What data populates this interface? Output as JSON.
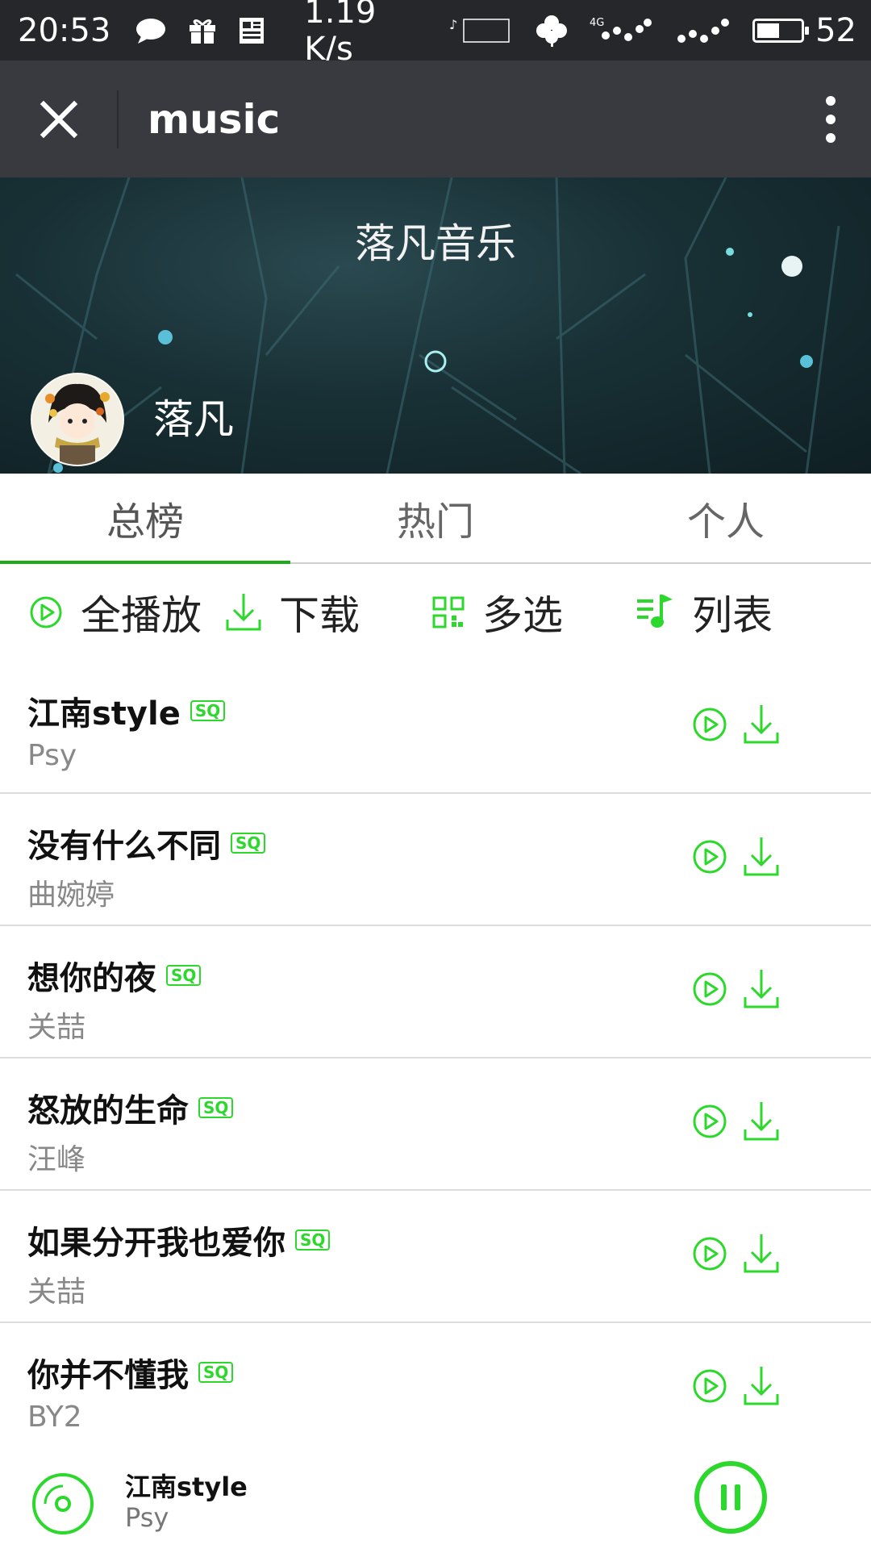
{
  "status_bar": {
    "time": "20:53",
    "speed": "1.19 K/s",
    "network": "4G",
    "battery": "52",
    "battery_level": 0.52
  },
  "top_bar": {
    "title": "music"
  },
  "banner": {
    "app_name": "落凡音乐",
    "user_name": "落凡"
  },
  "tabs": [
    {
      "label": "总榜",
      "active": true
    },
    {
      "label": "热门",
      "active": false
    },
    {
      "label": "个人",
      "active": false
    }
  ],
  "actions": [
    {
      "label": "全播放",
      "icon": "play-circle-icon"
    },
    {
      "label": "下载",
      "icon": "download-icon"
    },
    {
      "label": "多选",
      "icon": "multi-select-icon"
    },
    {
      "label": "列表",
      "icon": "playlist-icon"
    }
  ],
  "songs": [
    {
      "title": "江南style",
      "artist": "Psy",
      "badge": "SQ"
    },
    {
      "title": "没有什么不同",
      "artist": "曲婉婷",
      "badge": "SQ"
    },
    {
      "title": "想你的夜",
      "artist": "关喆",
      "badge": "SQ"
    },
    {
      "title": "怒放的生命",
      "artist": "汪峰",
      "badge": "SQ"
    },
    {
      "title": "如果分开我也爱你",
      "artist": "关喆",
      "badge": "SQ"
    },
    {
      "title": "你并不懂我",
      "artist": "BY2",
      "badge": "SQ"
    }
  ],
  "now_playing": {
    "title": "江南style",
    "artist": "Psy"
  },
  "colors": {
    "accent": "#1aad19",
    "icon_green": "#2bd82b",
    "topbar": "#393a3f",
    "statusbar": "#25272a"
  }
}
